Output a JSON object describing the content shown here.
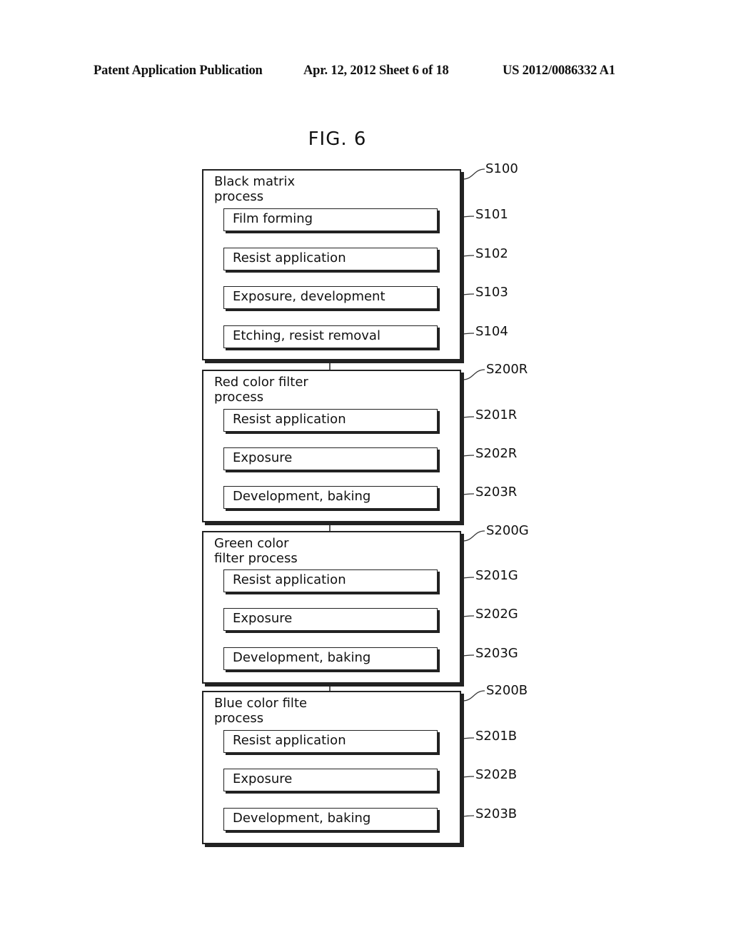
{
  "header": {
    "publication": "Patent Application Publication",
    "date_sheet": "Apr. 12, 2012  Sheet 6 of 18",
    "patent_number": "US 2012/0086332 A1"
  },
  "figure": {
    "title": "FIG. 6"
  },
  "groups": [
    {
      "title": "Black matrix\nprocess",
      "ref": "S100",
      "steps": [
        {
          "label": "Film forming",
          "ref": "S101"
        },
        {
          "label": "Resist application",
          "ref": "S102"
        },
        {
          "label": "Exposure, development",
          "ref": "S103"
        },
        {
          "label": "Etching, resist removal",
          "ref": "S104"
        }
      ]
    },
    {
      "title": "Red color filter\nprocess",
      "ref": "S200R",
      "steps": [
        {
          "label": "Resist application",
          "ref": "S201R"
        },
        {
          "label": "Exposure",
          "ref": "S202R"
        },
        {
          "label": "Development, baking",
          "ref": "S203R"
        }
      ]
    },
    {
      "title": "Green color\nfilter process",
      "ref": "S200G",
      "steps": [
        {
          "label": "Resist application",
          "ref": "S201G"
        },
        {
          "label": "Exposure",
          "ref": "S202G"
        },
        {
          "label": "Development, baking",
          "ref": "S203G"
        }
      ]
    },
    {
      "title": "Blue color filte\nprocess",
      "ref": "S200B",
      "steps": [
        {
          "label": "Resist application",
          "ref": "S201B"
        },
        {
          "label": "Exposure",
          "ref": "S202B"
        },
        {
          "label": "Development, baking",
          "ref": "S203B"
        }
      ]
    }
  ]
}
